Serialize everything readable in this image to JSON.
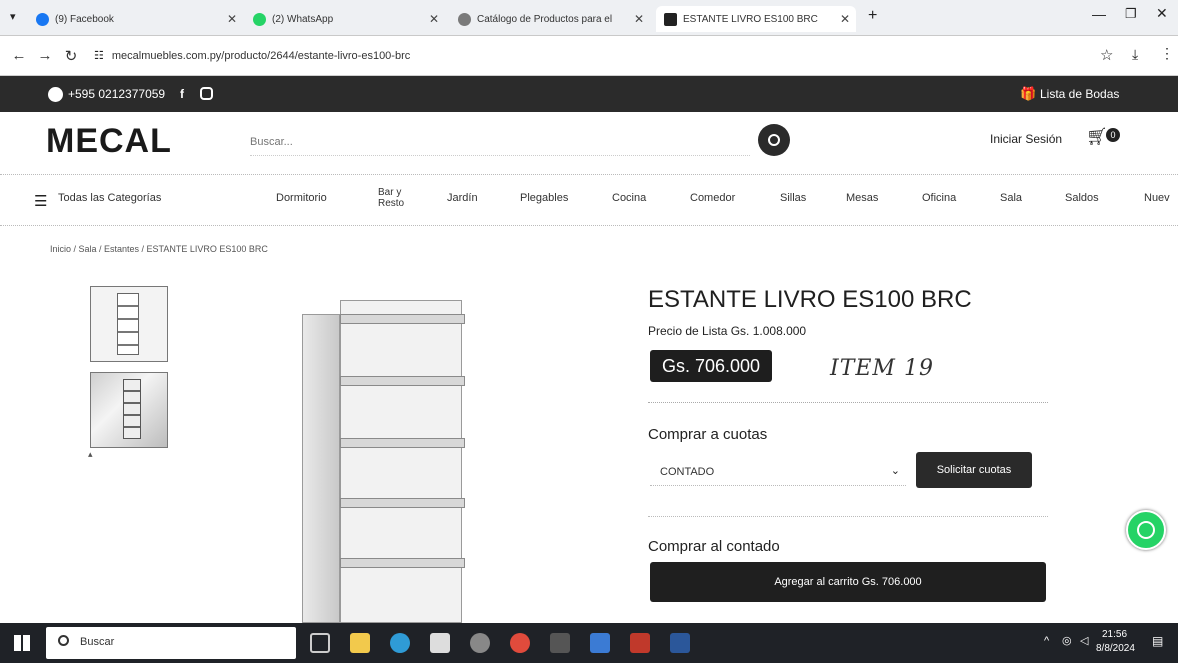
{
  "browser": {
    "tabs": [
      {
        "label": "(9) Facebook",
        "icon": "facebook-icon",
        "active": false
      },
      {
        "label": "(2) WhatsApp",
        "icon": "whatsapp-icon",
        "active": false
      },
      {
        "label": "Catálogo de Productos para el",
        "icon": "catalog-icon",
        "active": false
      },
      {
        "label": "ESTANTE LIVRO ES100 BRC",
        "icon": "mecal-icon",
        "active": true
      }
    ],
    "url": "mecalmuebles.com.py/producto/2644/estante-livro-es100-brc"
  },
  "topstrip": {
    "phone": "+595 0212377059",
    "wedding_list": "Lista de Bodas"
  },
  "header": {
    "logo": "MECAL",
    "search_placeholder": "Buscar...",
    "login": "Iniciar Sesión",
    "cart_count": "0"
  },
  "categories": {
    "all_label": "Todas las Categorías",
    "items": [
      "Dormitorio",
      "Bar y Resto",
      "Jardín",
      "Plegables",
      "Cocina",
      "Comedor",
      "Sillas",
      "Mesas",
      "Oficina",
      "Sala",
      "Saldos",
      "Nuev"
    ]
  },
  "breadcrumb": "Inicio / Sala / Estantes / ESTANTE LIVRO ES100 BRC",
  "product": {
    "title": "ESTANTE LIVRO ES100 BRC",
    "list_price": "Precio de Lista Gs. 1.008.000",
    "price": "Gs. 706.000",
    "handwritten_note": "ITEM 19",
    "installments_heading": "Comprar a cuotas",
    "installment_option": "CONTADO",
    "request_installments": "Solicitar cuotas",
    "cash_heading": "Comprar al contado",
    "add_to_cart": "Agregar al carrito Gs. 706.000"
  },
  "taskbar": {
    "search_label": "Buscar",
    "time": "21:56",
    "date": "8/8/2024"
  },
  "colors": {
    "dark": "#2b2b2b",
    "whatsapp": "#25d366",
    "price_bg": "#1e1e1e"
  }
}
